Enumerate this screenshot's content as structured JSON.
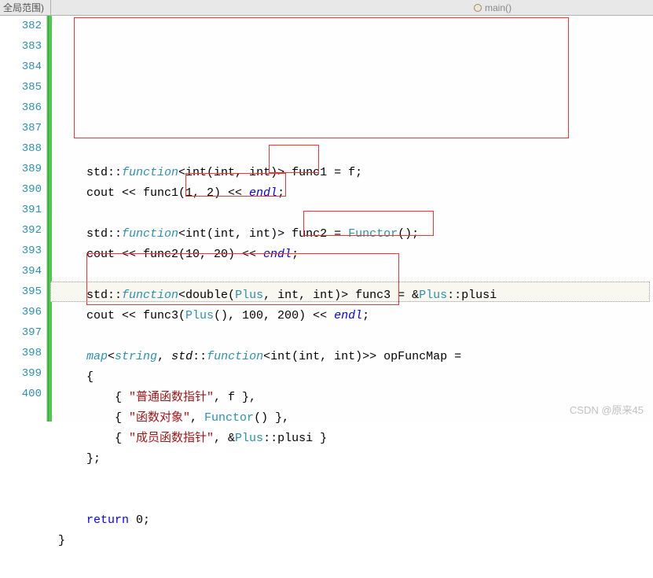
{
  "toolbar": {
    "scope_label": "全局范围)",
    "context_fn": "main()"
  },
  "lines": {
    "start": 382,
    "end": 400
  },
  "code": {
    "l382": {
      "pre": "    std",
      "after_ns": "::",
      "fn": "function",
      "tmpl": "<int(int, int)> func1 = f;"
    },
    "l383": {
      "pre": "    cout << func1(1, 2) << ",
      "endl": "endl",
      "post": ";"
    },
    "l384": {
      "blank": " "
    },
    "l385": {
      "pre": "    std",
      "after_ns": "::",
      "fn": "function",
      "tmpl": "<int(int, int)> func2 = ",
      "cls": "Functor",
      "post": "();"
    },
    "l386": {
      "pre": "    cout << func2(10, 20) << ",
      "endl": "endl",
      "post": ";"
    },
    "l387": {
      "blank": " "
    },
    "l388": {
      "pre": "    std",
      "after_ns": "::",
      "fn": "function",
      "tmpl1": "<double(",
      "cls": "Plus",
      "tmpl2": ", int, int)> func3 = &",
      "cls2": "Plus",
      "post": "::plusi"
    },
    "l389": {
      "pre": "    cout << func3(",
      "cls": "Plus",
      "post1": "(), 100, 200) << ",
      "endl": "endl",
      "post2": ";"
    },
    "l390": {
      "blank": " "
    },
    "l391": {
      "pre": "    ",
      "typekw": "map",
      "tmpl1": "<",
      "typekw2": "string",
      "tmpl2": ", ",
      "ns": "std",
      "after_ns": "::",
      "fn": "function",
      "tmpl3": "<int(int, int)>> opFuncMap ="
    },
    "l392": {
      "txt": "    {"
    },
    "l393": {
      "pre": "        { ",
      "str": "\"普通函数指针\"",
      "post": ", f },"
    },
    "l394": {
      "pre": "        { ",
      "str": "\"函数对象\"",
      "post": ", ",
      "cls": "Functor",
      "post2": "() },"
    },
    "l395": {
      "pre": "        { ",
      "str": "\"成员函数指针\"",
      "post": ", &",
      "cls": "Plus",
      "post2": "::plusi }"
    },
    "l396": {
      "txt": "    };"
    },
    "l397": {
      "blank": " "
    },
    "l398": {
      "blank": " "
    },
    "l399": {
      "pre": "    ",
      "kw": "return",
      "post": " 0;"
    },
    "l400": {
      "txt": "}"
    }
  },
  "watermark": "CSDN @原来45"
}
